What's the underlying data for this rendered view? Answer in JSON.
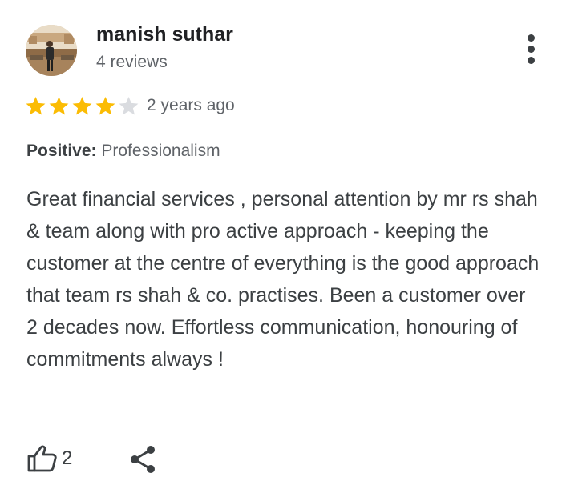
{
  "review": {
    "author": {
      "name": "manish suthar",
      "reviews_count": "4 reviews",
      "avatar": "user-photo"
    },
    "rating": {
      "value": 4,
      "max": 5,
      "filled_color": "#fbbc04",
      "empty_color": "#dadce0"
    },
    "date": "2 years ago",
    "highlight": {
      "label": "Positive:",
      "value": "Professionalism"
    },
    "text": "Great financial services , personal attention by mr rs shah & team along with pro active approach - keeping the customer at the centre of everything is the good approach that team rs shah & co. practises. Been a customer over 2 decades now. Effortless communication, honouring of commitments always !",
    "actions": {
      "like_count": "2",
      "like_icon": "thumbs-up-icon",
      "share_icon": "share-icon",
      "menu_icon": "more-vert-icon"
    }
  }
}
